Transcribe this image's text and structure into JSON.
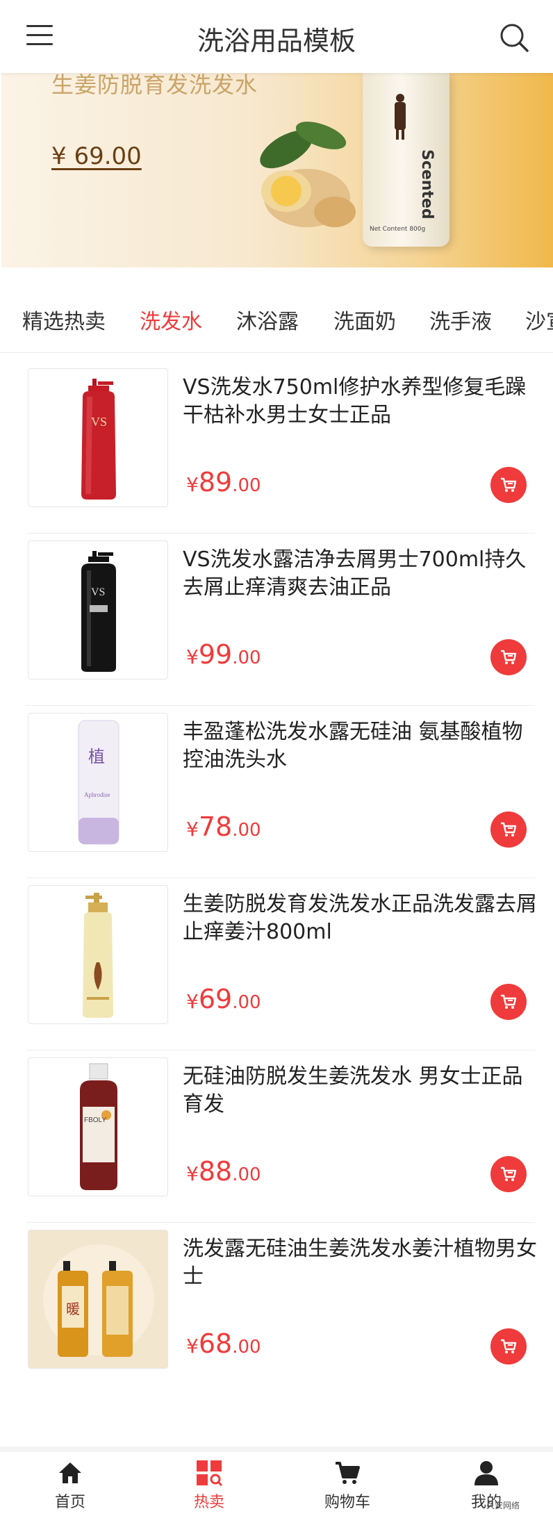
{
  "header": {
    "title": "洗浴用品模板",
    "menu_icon": "menu-icon",
    "search_icon": "search-icon"
  },
  "banner": {
    "slogan": "生姜防脱育发洗发水",
    "price": "¥ 69.00",
    "bottle_label": "Scented",
    "bottle_net": "Net Content 800g"
  },
  "tabs": [
    {
      "label": "精选热卖",
      "active": false
    },
    {
      "label": "洗发水",
      "active": true
    },
    {
      "label": "沐浴露",
      "active": false
    },
    {
      "label": "洗面奶",
      "active": false
    },
    {
      "label": "洗手液",
      "active": false
    },
    {
      "label": "沙宣",
      "active": false
    }
  ],
  "products": [
    {
      "name": "VS洗发水750ml修护水养型修复毛躁干枯补水男士女士正品",
      "symbol": "¥",
      "price_int": "89",
      "price_dec": ".00"
    },
    {
      "name": "VS洗发水露洁净去屑男士700ml持久去屑止痒清爽去油正品",
      "symbol": "¥",
      "price_int": "99",
      "price_dec": ".00"
    },
    {
      "name": "丰盈蓬松洗发水露无硅油 氨基酸植物控油洗头水",
      "symbol": "¥",
      "price_int": "78",
      "price_dec": ".00"
    },
    {
      "name": "生姜防脱发育发洗发水正品洗发露去屑止痒姜汁800ml",
      "symbol": "¥",
      "price_int": "69",
      "price_dec": ".00"
    },
    {
      "name": "无硅油防脱发生姜洗发水 男女士正品育发",
      "symbol": "¥",
      "price_int": "88",
      "price_dec": ".00"
    },
    {
      "name": "洗发露无硅油生姜洗发水姜汁植物男女士",
      "symbol": "¥",
      "price_int": "68",
      "price_dec": ".00"
    }
  ],
  "tabbar": [
    {
      "label": "首页",
      "icon": "home-icon",
      "active": false
    },
    {
      "label": "热卖",
      "icon": "hot-icon",
      "active": true
    },
    {
      "label": "购物车",
      "icon": "cart-icon",
      "active": false
    },
    {
      "label": "我的",
      "icon": "user-icon",
      "active": false
    }
  ],
  "watermark": "久安网络",
  "colors": {
    "accent": "#ef3b3b",
    "text": "#222222",
    "muted": "#eeeeee"
  }
}
